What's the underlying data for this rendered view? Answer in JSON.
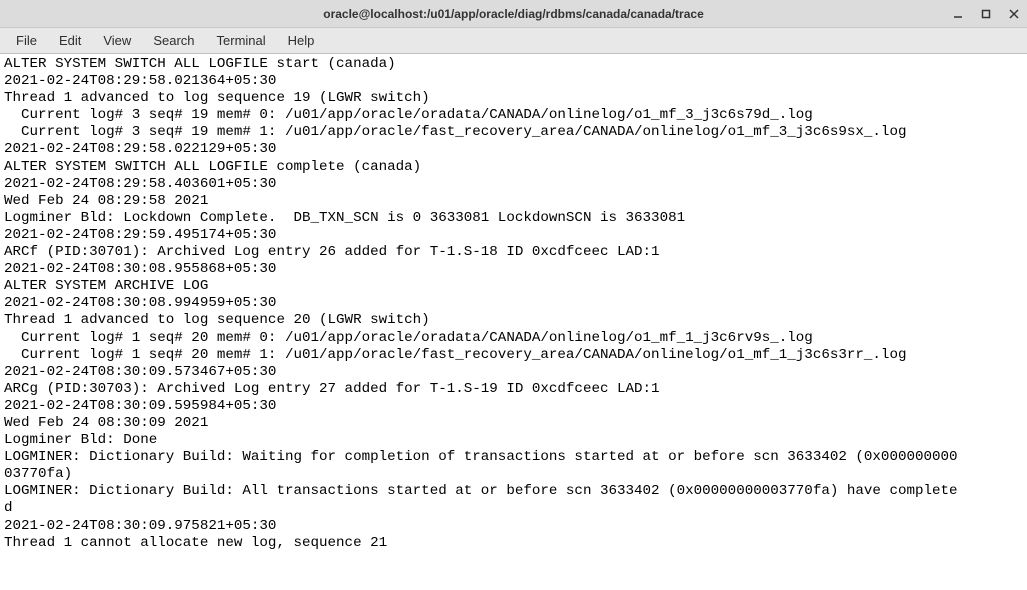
{
  "window": {
    "title": "oracle@localhost:/u01/app/oracle/diag/rdbms/canada/canada/trace"
  },
  "menu": {
    "file": "File",
    "edit": "Edit",
    "view": "View",
    "search": "Search",
    "terminal": "Terminal",
    "help": "Help"
  },
  "terminal": {
    "lines": [
      "ALTER SYSTEM SWITCH ALL LOGFILE start (canada)",
      "2021-02-24T08:29:58.021364+05:30",
      "Thread 1 advanced to log sequence 19 (LGWR switch)",
      "  Current log# 3 seq# 19 mem# 0: /u01/app/oracle/oradata/CANADA/onlinelog/o1_mf_3_j3c6s79d_.log",
      "  Current log# 3 seq# 19 mem# 1: /u01/app/oracle/fast_recovery_area/CANADA/onlinelog/o1_mf_3_j3c6s9sx_.log",
      "2021-02-24T08:29:58.022129+05:30",
      "ALTER SYSTEM SWITCH ALL LOGFILE complete (canada)",
      "2021-02-24T08:29:58.403601+05:30",
      "Wed Feb 24 08:29:58 2021",
      "Logminer Bld: Lockdown Complete.  DB_TXN_SCN is 0 3633081 LockdownSCN is 3633081",
      "2021-02-24T08:29:59.495174+05:30",
      "ARCf (PID:30701): Archived Log entry 26 added for T-1.S-18 ID 0xcdfceec LAD:1",
      "2021-02-24T08:30:08.955868+05:30",
      "ALTER SYSTEM ARCHIVE LOG",
      "2021-02-24T08:30:08.994959+05:30",
      "Thread 1 advanced to log sequence 20 (LGWR switch)",
      "  Current log# 1 seq# 20 mem# 0: /u01/app/oracle/oradata/CANADA/onlinelog/o1_mf_1_j3c6rv9s_.log",
      "  Current log# 1 seq# 20 mem# 1: /u01/app/oracle/fast_recovery_area/CANADA/onlinelog/o1_mf_1_j3c6s3rr_.log",
      "2021-02-24T08:30:09.573467+05:30",
      "ARCg (PID:30703): Archived Log entry 27 added for T-1.S-19 ID 0xcdfceec LAD:1",
      "2021-02-24T08:30:09.595984+05:30",
      "Wed Feb 24 08:30:09 2021",
      "Logminer Bld: Done",
      "LOGMINER: Dictionary Build: Waiting for completion of transactions started at or before scn 3633402 (0x000000000",
      "03770fa)",
      "LOGMINER: Dictionary Build: All transactions started at or before scn 3633402 (0x00000000003770fa) have complete",
      "d",
      "2021-02-24T08:30:09.975821+05:30",
      "Thread 1 cannot allocate new log, sequence 21"
    ]
  }
}
